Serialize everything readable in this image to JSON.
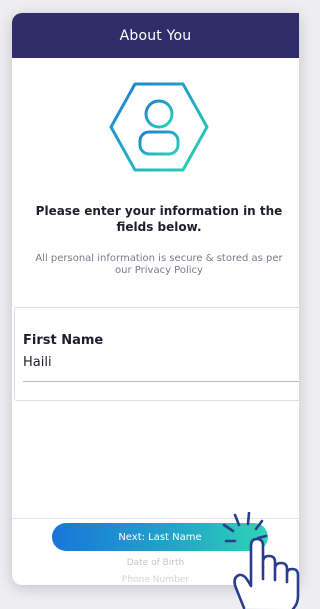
{
  "header": {
    "title": "About You"
  },
  "hero": {
    "icon": "user-hexagon-icon"
  },
  "intro": {
    "headline": "Please enter your information in the fields below.",
    "subtext": "All personal information is secure & stored as per our Privacy Policy"
  },
  "form": {
    "first_name": {
      "label": "First Name",
      "value": "Haili"
    }
  },
  "footer": {
    "next_label": "Next: Last Name",
    "upcoming_steps": [
      "Date of Birth",
      "Phone Number"
    ]
  },
  "overlay": {
    "icon": "tap-hand-icon"
  },
  "colors": {
    "header_bg": "#302d6b",
    "accent_start": "#1976d8",
    "accent_end": "#2fd5b3",
    "hand_stroke": "#2a3d8f"
  }
}
